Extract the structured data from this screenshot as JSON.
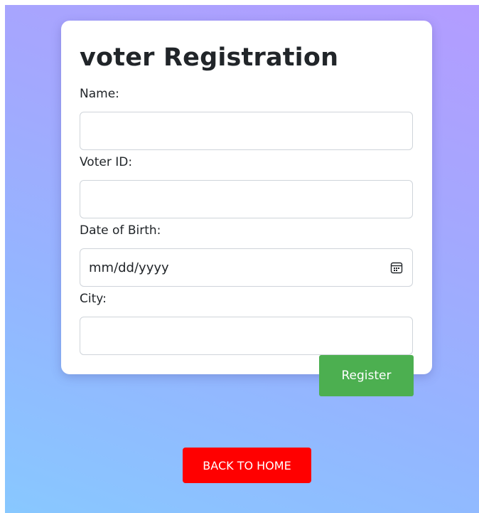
{
  "form": {
    "title": "voter Registration",
    "fields": {
      "name": {
        "label": "Name:",
        "value": ""
      },
      "voter_id": {
        "label": "Voter ID:",
        "value": ""
      },
      "dob": {
        "label": "Date of Birth:",
        "placeholder": "mm/dd/yyyy"
      },
      "city": {
        "label": "City:",
        "value": ""
      }
    },
    "register_label": "Register"
  },
  "nav": {
    "back_label": "BACK TO HOME"
  },
  "colors": {
    "register_bg": "#4caf50",
    "back_bg": "#ff0000",
    "gradient_top": "#b39cff",
    "gradient_bottom": "#88c8ff"
  },
  "icons": {
    "date_picker": "calendar-icon"
  }
}
